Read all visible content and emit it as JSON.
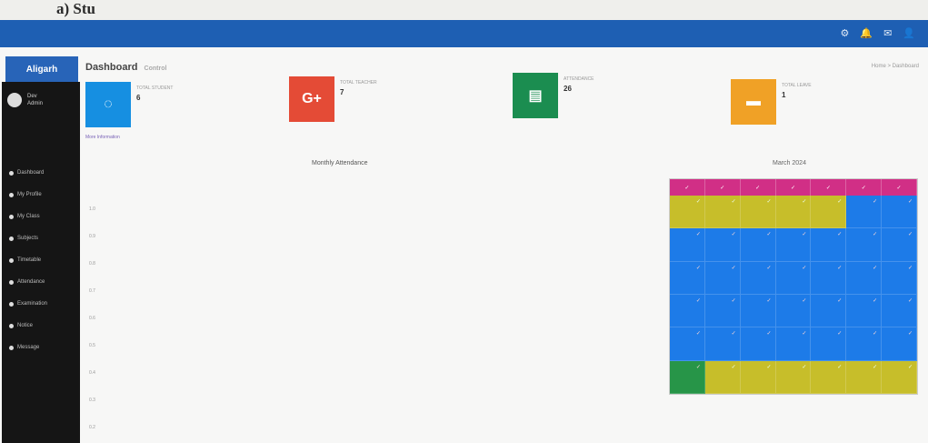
{
  "caption": "a) Stu",
  "topbar": {
    "icons": [
      "settings-icon",
      "bell-icon",
      "mail-icon",
      "user-icon"
    ]
  },
  "sidebar": {
    "brand": "Aligarh",
    "user_name": "Dev",
    "user_sub": "Admin",
    "nav_items": [
      "Dashboard",
      "My Profile",
      "My Class",
      "Subjects",
      "Timetable",
      "Attendance",
      "Examination",
      "Notice",
      "Message"
    ]
  },
  "header": {
    "title": "Dashboard",
    "subtitle": "Control",
    "breadcrumb": "Home > Dashboard"
  },
  "cards": [
    {
      "label": "TOTAL STUDENT",
      "value": "6",
      "color": "#168fe1",
      "icon": "student-icon"
    },
    {
      "label": "TOTAL TEACHER",
      "value": "7",
      "color": "#e44b36",
      "icon": "google-plus-icon"
    },
    {
      "label": "ATTENDANCE",
      "value": "26",
      "color": "#1b8d50",
      "icon": "cart-icon"
    },
    {
      "label": "TOTAL LEAVE",
      "value": "1",
      "color": "#f0a126",
      "icon": "folder-icon"
    }
  ],
  "more_info_link": "More Information",
  "chart": {
    "title": "Monthly Attendance",
    "y_labels": [
      "1.0",
      "0.9",
      "0.8",
      "0.7",
      "0.6",
      "0.5",
      "0.4",
      "0.3",
      "0.2"
    ]
  },
  "calendar": {
    "title": "March 2024",
    "days": [
      "✓",
      "✓",
      "✓",
      "✓",
      "✓",
      "✓",
      "✓"
    ],
    "rows": [
      [
        "y",
        "y",
        "y",
        "y",
        "y",
        "b",
        "b"
      ],
      [
        "b",
        "b",
        "b",
        "b",
        "b",
        "b",
        "b"
      ],
      [
        "b",
        "b",
        "b",
        "b",
        "b",
        "b",
        "b"
      ],
      [
        "b",
        "b",
        "b",
        "b",
        "b",
        "b",
        "b"
      ],
      [
        "b",
        "b",
        "b",
        "b",
        "b",
        "b",
        "b"
      ],
      [
        "g",
        "y",
        "y",
        "y",
        "y",
        "y",
        "y"
      ]
    ]
  }
}
